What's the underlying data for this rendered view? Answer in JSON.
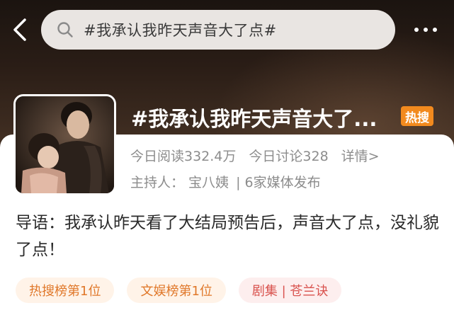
{
  "search": {
    "query": "#我承认我昨天声音大了点#"
  },
  "topic": {
    "title": "#我承认我昨天声音大了...",
    "badge": "热搜",
    "reads": "今日阅读332.4万",
    "discussions": "今日讨论328",
    "detail_link": "详情>",
    "host_label": "主持人：",
    "host_name": "宝八姨",
    "media": "| 6家媒体发布"
  },
  "intro": {
    "text": "导语：我承认昨天看了大结局预告后，声音大了点，没礼貌了点！"
  },
  "tags": [
    {
      "label": "热搜榜第1位"
    },
    {
      "label": "文娱榜第1位"
    },
    {
      "label": "剧集 | 苍兰诀"
    }
  ],
  "icons": {
    "back": "chevron-left-icon",
    "search": "search-icon",
    "more": "more-dots-icon"
  },
  "colors": {
    "header": "#2a1d16",
    "badge": "#f28a1e",
    "tag_orange": "#e0782a",
    "tag_red": "#d9534f"
  }
}
